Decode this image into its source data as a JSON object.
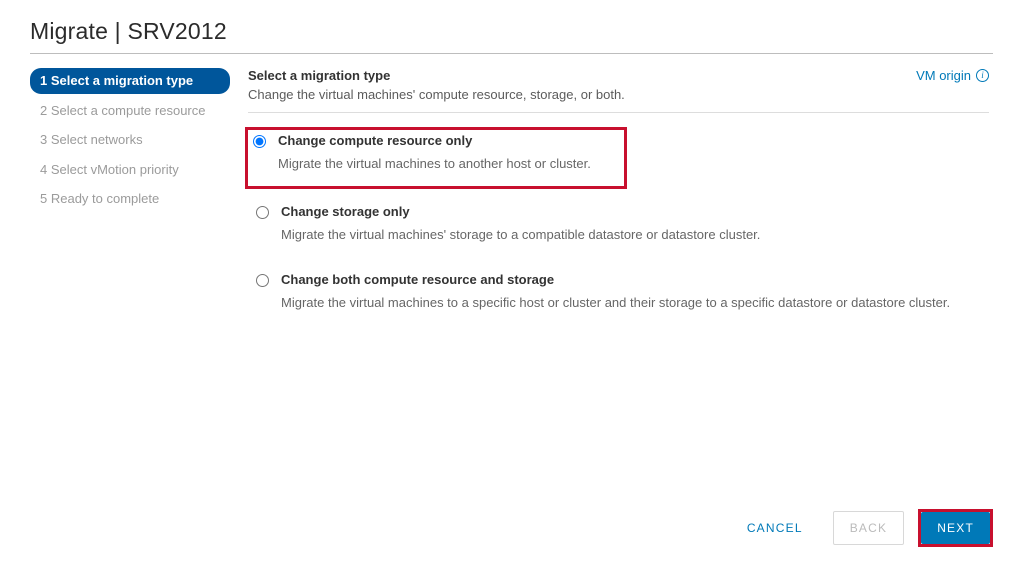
{
  "title": "Migrate | SRV2012",
  "steps": [
    {
      "label": "1 Select a migration type",
      "active": true
    },
    {
      "label": "2 Select a compute resource",
      "active": false
    },
    {
      "label": "3 Select networks",
      "active": false
    },
    {
      "label": "4 Select vMotion priority",
      "active": false
    },
    {
      "label": "5 Ready to complete",
      "active": false
    }
  ],
  "main": {
    "heading": "Select a migration type",
    "subheading": "Change the virtual machines' compute resource, storage, or both.",
    "vm_origin_label": "VM origin"
  },
  "options": [
    {
      "id": "compute",
      "title": "Change compute resource only",
      "desc": "Migrate the virtual machines to another host or cluster.",
      "selected": true,
      "highlight": true
    },
    {
      "id": "storage",
      "title": "Change storage only",
      "desc": "Migrate the virtual machines' storage to a compatible datastore or datastore cluster.",
      "selected": false,
      "highlight": false
    },
    {
      "id": "both",
      "title": "Change both compute resource and storage",
      "desc": "Migrate the virtual machines to a specific host or cluster and their storage to a specific datastore or datastore cluster.",
      "selected": false,
      "highlight": false
    }
  ],
  "footer": {
    "cancel": "CANCEL",
    "back": "BACK",
    "next": "NEXT"
  }
}
